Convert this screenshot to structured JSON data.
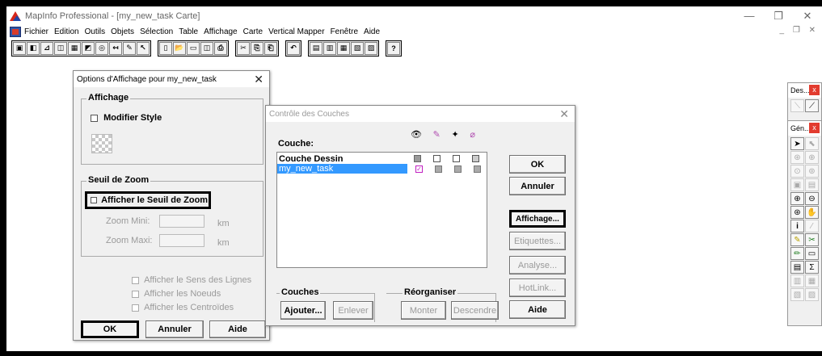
{
  "app": {
    "title": "MapInfo Professional - [my_new_task Carte]",
    "window_controls": [
      "—",
      "❐",
      "✕"
    ],
    "mdi_controls": "_ ❐ ✕"
  },
  "menu": [
    "Fichier",
    "Edition",
    "Outils",
    "Objets",
    "Sélection",
    "Table",
    "Affichage",
    "Carte",
    "Vertical Mapper",
    "Fenêtre",
    "Aide"
  ],
  "toolbar": {
    "group1": [
      "▣",
      "◧",
      "⊿",
      "◫",
      "▦",
      "◩",
      "◎",
      "↤",
      "✎",
      "↖"
    ],
    "group2": [
      "▯",
      "📂",
      "▭",
      "◫",
      "⎙"
    ],
    "group3": [
      "✂",
      "⎘",
      "⎗"
    ],
    "group4": [
      "↶"
    ],
    "group5": [
      "▤",
      "▥",
      "▦",
      "▧",
      "▨"
    ],
    "group6": [
      "?"
    ]
  },
  "options_dialog": {
    "title": "Options d'Affichage pour my_new_task",
    "affichage_group": "Affichage",
    "modifier_style": "Modifier Style",
    "seuil_group": "Seuil de Zoom",
    "afficher_seuil": "Afficher le Seuil de Zoom",
    "zoom_mini_label": "Zoom Mini:",
    "zoom_maxi_label": "Zoom Maxi:",
    "unit_mini": "km",
    "unit_maxi": "km",
    "sens_lignes": "Afficher le Sens des Lignes",
    "noeuds": "Afficher les Noeuds",
    "centroides": "Afficher les Centroïdes",
    "ok": "OK",
    "annuler": "Annuler",
    "aide": "Aide"
  },
  "layers_dialog": {
    "title": "Contrôle des Couches",
    "couche_label": "Couche:",
    "layers": [
      {
        "name": "Couche Dessin",
        "selected": false
      },
      {
        "name": "my_new_task",
        "selected": true
      }
    ],
    "ok": "OK",
    "annuler": "Annuler",
    "affichage": "Affichage...",
    "etiquettes": "Etiquettes...",
    "analyse": "Analyse...",
    "hotlink": "HotLink...",
    "aide": "Aide",
    "couches_group": "Couches",
    "ajouter": "Ajouter...",
    "enlever": "Enlever",
    "reorganiser_group": "Réorganiser",
    "monter": "Monter",
    "descendre": "Descendre"
  },
  "palettes": {
    "des_title": "Des...",
    "gen_title": "Gén...",
    "close": "x",
    "des_tools": [
      "⟍",
      "⟋"
    ],
    "gen_tools": [
      "➤",
      "⬉",
      "⊛",
      "⊕",
      "⊙",
      "⊚",
      "▣",
      "▤",
      "⊕",
      "⊖",
      "⊛",
      "✋",
      "i",
      "⁄",
      "✎",
      "✂",
      "✏",
      "▭",
      "▤",
      "Σ",
      "▥",
      "▦",
      "▧",
      "▨"
    ]
  },
  "colors": {
    "checkbox_accent": "#c01fc0",
    "selection": "#3399ff"
  }
}
